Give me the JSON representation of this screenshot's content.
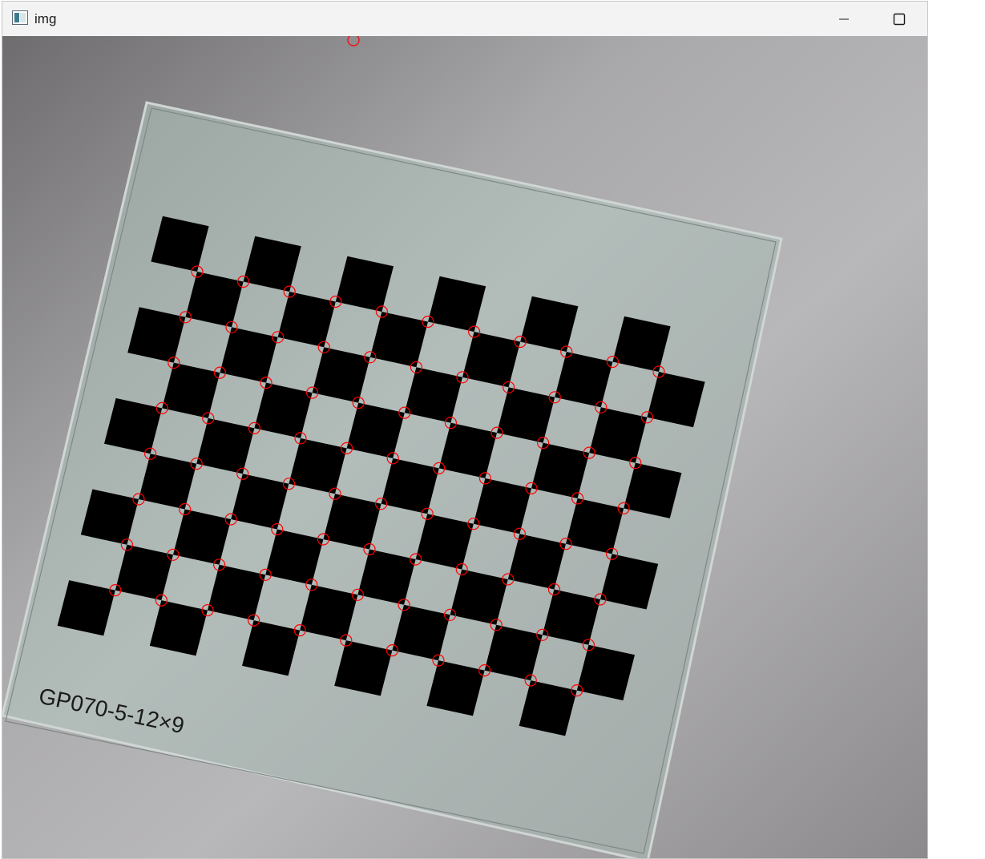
{
  "window": {
    "title": "img",
    "icon": "opencv-window-icon",
    "controls": [
      "minimize-icon",
      "maximize-icon"
    ]
  },
  "image": {
    "board_label": "GP070-5-12×9",
    "corner_marker_color": "#ff0000",
    "checker_color": "#000000",
    "board_color": "#a9b3b0"
  }
}
